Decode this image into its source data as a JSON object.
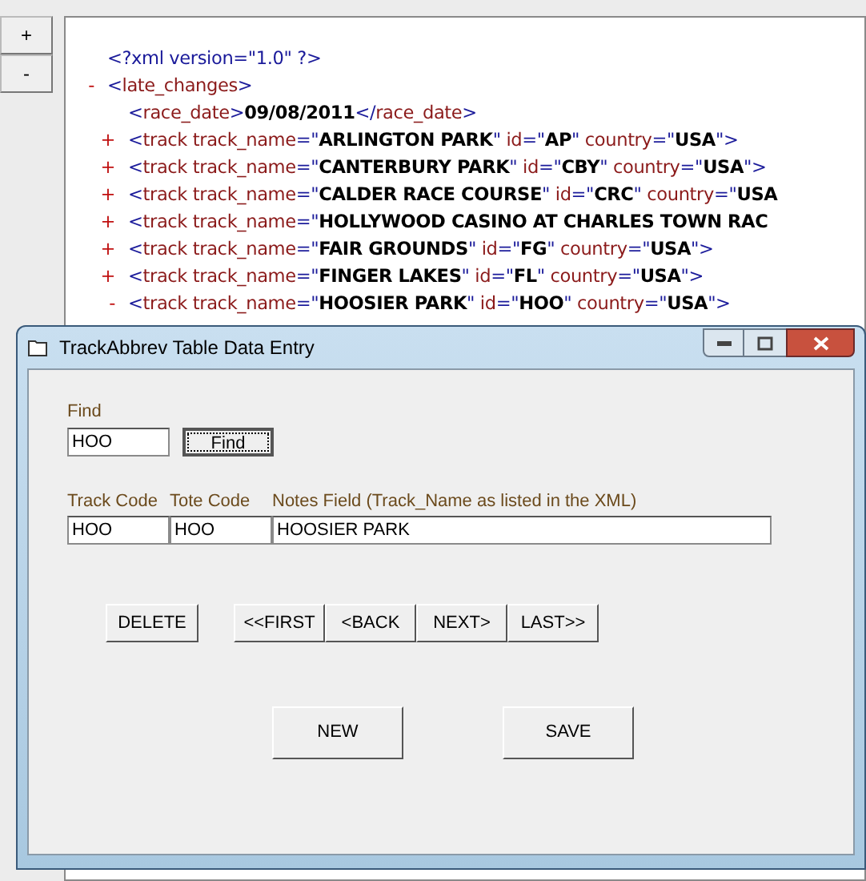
{
  "zoom_buttons": [
    "+",
    "-"
  ],
  "xml": [
    {
      "parts": [
        {
          "kind": "punct",
          "text": "<?xml version=\"1.0\" ?>"
        }
      ]
    },
    {
      "toggle": "-",
      "parts": [
        {
          "kind": "punct",
          "text": "<"
        },
        {
          "kind": "name",
          "text": "late_changes"
        },
        {
          "kind": "punct",
          "text": ">"
        }
      ],
      "children": [
        {
          "parts": [
            {
              "kind": "punct",
              "text": "<"
            },
            {
              "kind": "name",
              "text": "race_date"
            },
            {
              "kind": "punct",
              "text": ">"
            },
            {
              "kind": "value",
              "text": "09/08/2011"
            },
            {
              "kind": "punct",
              "text": "</"
            },
            {
              "kind": "name",
              "text": "race_date"
            },
            {
              "kind": "punct",
              "text": ">"
            }
          ]
        },
        {
          "toggle": "+",
          "parts": [
            {
              "kind": "punct",
              "text": "<"
            },
            {
              "kind": "name",
              "text": "track track_name"
            },
            {
              "kind": "punct",
              "text": "=\""
            },
            {
              "kind": "value",
              "text": "ARLINGTON PARK"
            },
            {
              "kind": "punct",
              "text": "\""
            },
            {
              "kind": "name",
              "text": " id"
            },
            {
              "kind": "punct",
              "text": "=\""
            },
            {
              "kind": "value",
              "text": "AP"
            },
            {
              "kind": "punct",
              "text": "\""
            },
            {
              "kind": "name",
              "text": " country"
            },
            {
              "kind": "punct",
              "text": "=\""
            },
            {
              "kind": "value",
              "text": "USA"
            },
            {
              "kind": "punct",
              "text": "\">"
            }
          ]
        },
        {
          "toggle": "+",
          "parts": [
            {
              "kind": "punct",
              "text": "<"
            },
            {
              "kind": "name",
              "text": "track track_name"
            },
            {
              "kind": "punct",
              "text": "=\""
            },
            {
              "kind": "value",
              "text": "CANTERBURY PARK"
            },
            {
              "kind": "punct",
              "text": "\""
            },
            {
              "kind": "name",
              "text": " id"
            },
            {
              "kind": "punct",
              "text": "=\""
            },
            {
              "kind": "value",
              "text": "CBY"
            },
            {
              "kind": "punct",
              "text": "\""
            },
            {
              "kind": "name",
              "text": " country"
            },
            {
              "kind": "punct",
              "text": "=\""
            },
            {
              "kind": "value",
              "text": "USA"
            },
            {
              "kind": "punct",
              "text": "\">"
            }
          ]
        },
        {
          "toggle": "+",
          "parts": [
            {
              "kind": "punct",
              "text": "<"
            },
            {
              "kind": "name",
              "text": "track track_name"
            },
            {
              "kind": "punct",
              "text": "=\""
            },
            {
              "kind": "value",
              "text": "CALDER RACE COURSE"
            },
            {
              "kind": "punct",
              "text": "\""
            },
            {
              "kind": "name",
              "text": " id"
            },
            {
              "kind": "punct",
              "text": "=\""
            },
            {
              "kind": "value",
              "text": "CRC"
            },
            {
              "kind": "punct",
              "text": "\""
            },
            {
              "kind": "name",
              "text": " country"
            },
            {
              "kind": "punct",
              "text": "=\""
            },
            {
              "kind": "value",
              "text": "USA"
            }
          ]
        },
        {
          "toggle": "+",
          "parts": [
            {
              "kind": "punct",
              "text": "<"
            },
            {
              "kind": "name",
              "text": "track track_name"
            },
            {
              "kind": "punct",
              "text": "=\""
            },
            {
              "kind": "value",
              "text": "HOLLYWOOD CASINO AT CHARLES TOWN RAC"
            }
          ]
        },
        {
          "toggle": "+",
          "parts": [
            {
              "kind": "punct",
              "text": "<"
            },
            {
              "kind": "name",
              "text": "track track_name"
            },
            {
              "kind": "punct",
              "text": "=\""
            },
            {
              "kind": "value",
              "text": "FAIR GROUNDS"
            },
            {
              "kind": "punct",
              "text": "\""
            },
            {
              "kind": "name",
              "text": " id"
            },
            {
              "kind": "punct",
              "text": "=\""
            },
            {
              "kind": "value",
              "text": "FG"
            },
            {
              "kind": "punct",
              "text": "\""
            },
            {
              "kind": "name",
              "text": " country"
            },
            {
              "kind": "punct",
              "text": "=\""
            },
            {
              "kind": "value",
              "text": "USA"
            },
            {
              "kind": "punct",
              "text": "\">"
            }
          ]
        },
        {
          "toggle": "+",
          "parts": [
            {
              "kind": "punct",
              "text": "<"
            },
            {
              "kind": "name",
              "text": "track track_name"
            },
            {
              "kind": "punct",
              "text": "=\""
            },
            {
              "kind": "value",
              "text": "FINGER LAKES"
            },
            {
              "kind": "punct",
              "text": "\""
            },
            {
              "kind": "name",
              "text": " id"
            },
            {
              "kind": "punct",
              "text": "=\""
            },
            {
              "kind": "value",
              "text": "FL"
            },
            {
              "kind": "punct",
              "text": "\""
            },
            {
              "kind": "name",
              "text": " country"
            },
            {
              "kind": "punct",
              "text": "=\""
            },
            {
              "kind": "value",
              "text": "USA"
            },
            {
              "kind": "punct",
              "text": "\">"
            }
          ]
        },
        {
          "toggle": "-",
          "parts": [
            {
              "kind": "punct",
              "text": "<"
            },
            {
              "kind": "name",
              "text": "track track_name"
            },
            {
              "kind": "punct",
              "text": "=\""
            },
            {
              "kind": "value",
              "text": "HOOSIER PARK"
            },
            {
              "kind": "punct",
              "text": "\""
            },
            {
              "kind": "name",
              "text": " id"
            },
            {
              "kind": "punct",
              "text": "=\""
            },
            {
              "kind": "value",
              "text": "HOO"
            },
            {
              "kind": "punct",
              "text": "\""
            },
            {
              "kind": "name",
              "text": " country"
            },
            {
              "kind": "punct",
              "text": "=\""
            },
            {
              "kind": "value",
              "text": "USA"
            },
            {
              "kind": "punct",
              "text": "\">"
            }
          ]
        }
      ]
    }
  ],
  "dialog": {
    "title": "TrackAbbrev Table Data Entry",
    "find": {
      "label": "Find",
      "value": "HOO",
      "button": "Find"
    },
    "fields": [
      {
        "label": "Track Code",
        "value": "HOO"
      },
      {
        "label": "Tote Code",
        "value": "HOO"
      },
      {
        "label": "Notes Field (Track_Name as listed in the XML)",
        "value": "HOOSIER PARK"
      }
    ],
    "delete_button": "DELETE",
    "nav_buttons": [
      "<<FIRST",
      "<BACK",
      "NEXT>",
      "LAST>>"
    ],
    "action_buttons": [
      "NEW",
      "SAVE"
    ]
  }
}
